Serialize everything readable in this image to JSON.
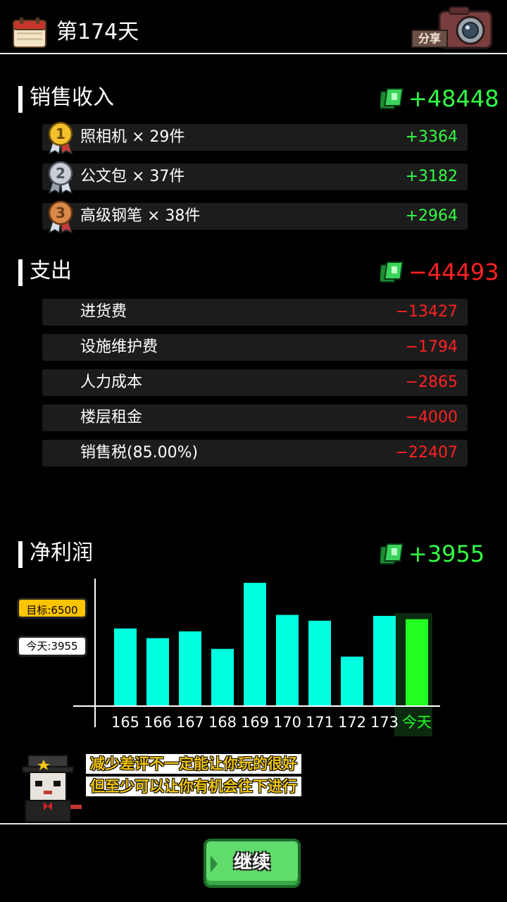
{
  "header": {
    "day_title": "第174天",
    "share_label": "分享"
  },
  "sales": {
    "title": "销售收入",
    "total": "+48448",
    "items": [
      {
        "rank": "1",
        "label": "照相机 × 29件",
        "value": "+3364"
      },
      {
        "rank": "2",
        "label": "公文包 × 37件",
        "value": "+3182"
      },
      {
        "rank": "3",
        "label": "高级钢笔 × 38件",
        "value": "+2964"
      }
    ]
  },
  "expenses": {
    "title": "支出",
    "total": "−44493",
    "items": [
      {
        "label": "进货费",
        "value": "−13427"
      },
      {
        "label": "设施维护费",
        "value": "−1794"
      },
      {
        "label": "人力成本",
        "value": "−2865"
      },
      {
        "label": "楼层租金",
        "value": "−4000"
      },
      {
        "label": "销售税(85.00%)",
        "value": "−22407"
      }
    ]
  },
  "net_profit": {
    "title": "净利润",
    "total": "+3955",
    "goal_label": "目标:6500",
    "today_label": "今天:3955"
  },
  "chart_data": {
    "type": "bar",
    "categories": [
      "165",
      "166",
      "167",
      "168",
      "169",
      "170",
      "171",
      "172",
      "173",
      "今天"
    ],
    "values": [
      4000,
      3500,
      3850,
      2950,
      6350,
      4700,
      4400,
      2550,
      4650,
      4480
    ],
    "ylim": [
      0,
      6500
    ],
    "highlight_index": 9,
    "colors": {
      "bar": "#00ffe0",
      "today": "#22ff22",
      "today_bg": "#0b2a10"
    }
  },
  "dialog": {
    "line1": "减少差评不一定能让你玩的很好",
    "line2": "但至少可以让你有机会往下进行"
  },
  "footer": {
    "continue_label": "继续"
  },
  "colors": {
    "positive": "#33ff44",
    "negative": "#ff2222"
  }
}
